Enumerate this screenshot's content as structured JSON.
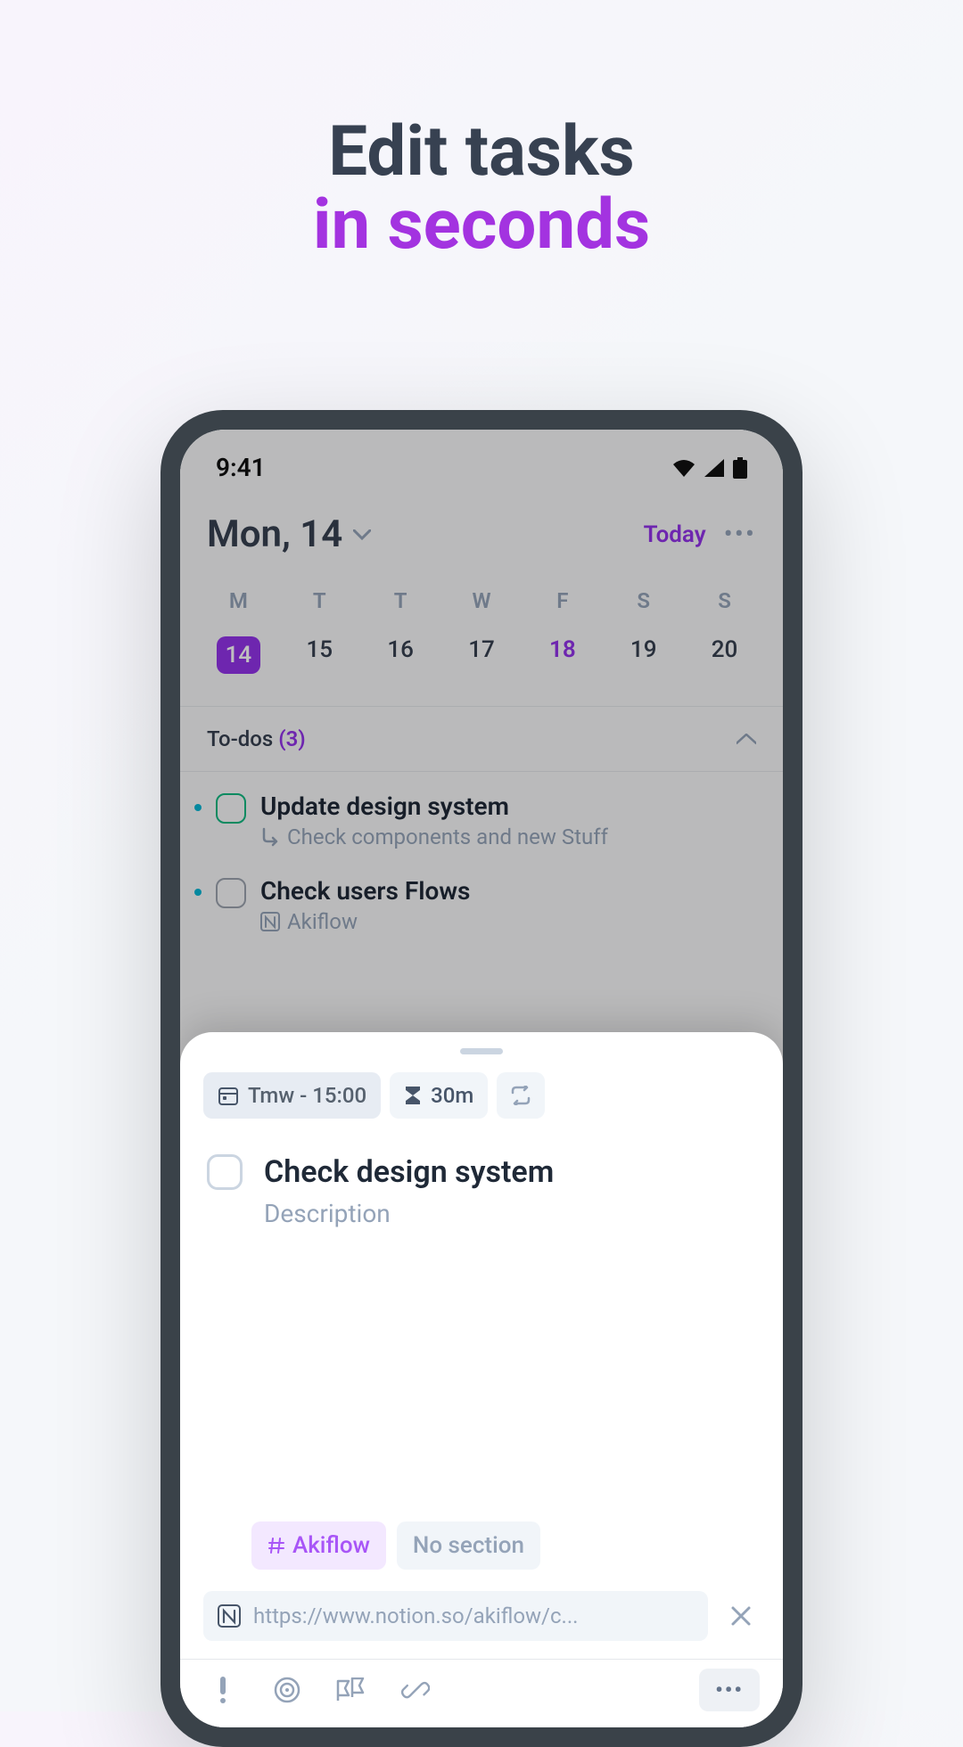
{
  "headline": {
    "line1": "Edit tasks",
    "line2": "in seconds"
  },
  "status": {
    "time": "9:41"
  },
  "header": {
    "date": "Mon, 14",
    "today": "Today"
  },
  "week": {
    "labels": [
      "M",
      "T",
      "T",
      "W",
      "F",
      "S",
      "S"
    ],
    "days": [
      "14",
      "15",
      "16",
      "17",
      "18",
      "19",
      "20"
    ]
  },
  "section": {
    "title": "To-dos",
    "count": "(3)"
  },
  "tasks": [
    {
      "title": "Update design system",
      "sub": "Check components and new Stuff",
      "sub_kind": "indent"
    },
    {
      "title": "Check users Flows",
      "sub": "Akiflow",
      "sub_kind": "notion"
    }
  ],
  "editor": {
    "date_chip": "Tmw - 15:00",
    "duration_chip": "30m",
    "title": "Check design system",
    "description_placeholder": "Description",
    "tag_primary": "Akiflow",
    "tag_secondary": "No section",
    "attachment_url": "https://www.notion.so/akiflow/c..."
  }
}
